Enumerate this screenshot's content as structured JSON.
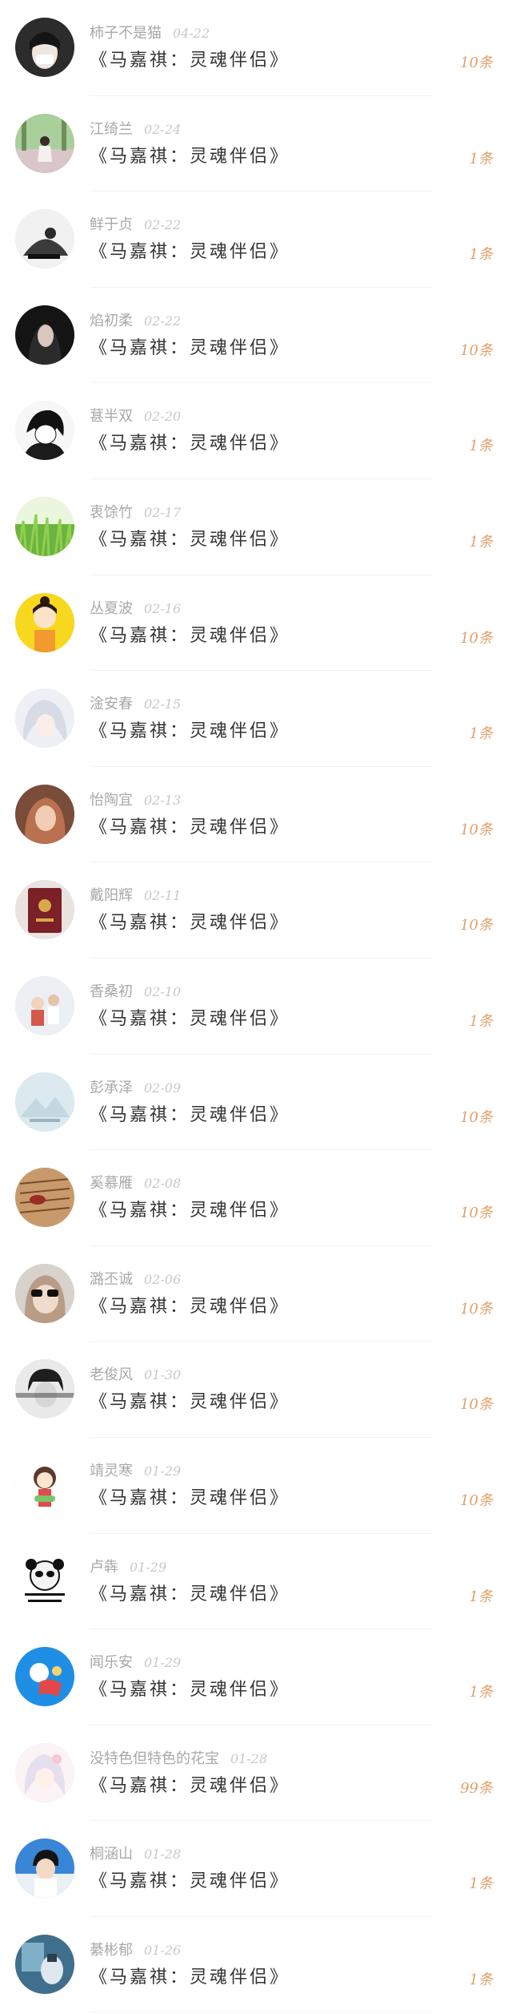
{
  "colors": {
    "name": "#a8a8a8",
    "date": "#c8c8c8",
    "title": "#333333",
    "count": "#e2a06a",
    "divider": "#f1f1f1"
  },
  "items": [
    {
      "name": "柿子不是猫",
      "date": "04-22",
      "title": "《马嘉祺：灵魂伴侣》",
      "count": "10条",
      "avatar": "sick-girl-avatar"
    },
    {
      "name": "江绮兰",
      "date": "02-24",
      "title": "《马嘉祺：灵魂伴侣》",
      "count": "1条",
      "avatar": "girl-in-park-avatar"
    },
    {
      "name": "鲜于贞",
      "date": "02-22",
      "title": "《马嘉祺：灵魂伴侣》",
      "count": "1条",
      "avatar": "sketch-couple-avatar"
    },
    {
      "name": "焰初柔",
      "date": "02-22",
      "title": "《马嘉祺：灵魂伴侣》",
      "count": "10条",
      "avatar": "dark-woman-avatar"
    },
    {
      "name": "葚半双",
      "date": "02-20",
      "title": "《马嘉祺：灵魂伴侣》",
      "count": "1条",
      "avatar": "anime-boy-avatar"
    },
    {
      "name": "衷馀竹",
      "date": "02-17",
      "title": "《马嘉祺：灵魂伴侣》",
      "count": "1条",
      "avatar": "grass-avatar"
    },
    {
      "name": "丛夏波",
      "date": "02-16",
      "title": "《马嘉祺：灵魂伴侣》",
      "count": "10条",
      "avatar": "cartoon-girl-avatar"
    },
    {
      "name": "淦安春",
      "date": "02-15",
      "title": "《马嘉祺：灵魂伴侣》",
      "count": "1条",
      "avatar": "white-hair-anime-avatar"
    },
    {
      "name": "怡陶宜",
      "date": "02-13",
      "title": "《马嘉祺：灵魂伴侣》",
      "count": "10条",
      "avatar": "selfie-girl-avatar"
    },
    {
      "name": "戴阳辉",
      "date": "02-11",
      "title": "《马嘉祺：灵魂伴侣》",
      "count": "10条",
      "avatar": "red-certificate-avatar"
    },
    {
      "name": "香桑初",
      "date": "02-10",
      "title": "《马嘉祺：灵魂伴侣》",
      "count": "1条",
      "avatar": "kids-photo-avatar"
    },
    {
      "name": "彭承泽",
      "date": "02-09",
      "title": "《马嘉祺：灵魂伴侣》",
      "count": "10条",
      "avatar": "mountain-placeholder-avatar"
    },
    {
      "name": "奚慕雁",
      "date": "02-08",
      "title": "《马嘉祺：灵魂伴侣》",
      "count": "10条",
      "avatar": "book-page-avatar"
    },
    {
      "name": "潞丕诚",
      "date": "02-06",
      "title": "《马嘉祺：灵魂伴侣》",
      "count": "10条",
      "avatar": "sunglasses-avatar"
    },
    {
      "name": "老俊风",
      "date": "01-30",
      "title": "《马嘉祺：灵魂伴侣》",
      "count": "10条",
      "avatar": "bw-boy-avatar"
    },
    {
      "name": "靖灵寒",
      "date": "01-29",
      "title": "《马嘉祺：灵魂伴侣》",
      "count": "10条",
      "avatar": "chibi-girl-avatar"
    },
    {
      "name": "卢犇",
      "date": "01-29",
      "title": "《马嘉祺：灵魂伴侣》",
      "count": "1条",
      "avatar": "panda-meme-avatar"
    },
    {
      "name": "闻乐安",
      "date": "01-29",
      "title": "《马嘉祺：灵魂伴侣》",
      "count": "1条",
      "avatar": "blue-cartoon-avatar"
    },
    {
      "name": "没特色但特色的花宝",
      "date": "01-28",
      "title": "《马嘉祺：灵魂伴侣》",
      "count": "99条",
      "avatar": "pastel-anime-avatar"
    },
    {
      "name": "桐涵山",
      "date": "01-28",
      "title": "《马嘉祺：灵魂伴侣》",
      "count": "1条",
      "avatar": "boy-blue-sky-avatar"
    },
    {
      "name": "綦彬郁",
      "date": "01-26",
      "title": "《马嘉祺：灵魂伴侣》",
      "count": "1条",
      "avatar": "blue-room-avatar"
    }
  ]
}
